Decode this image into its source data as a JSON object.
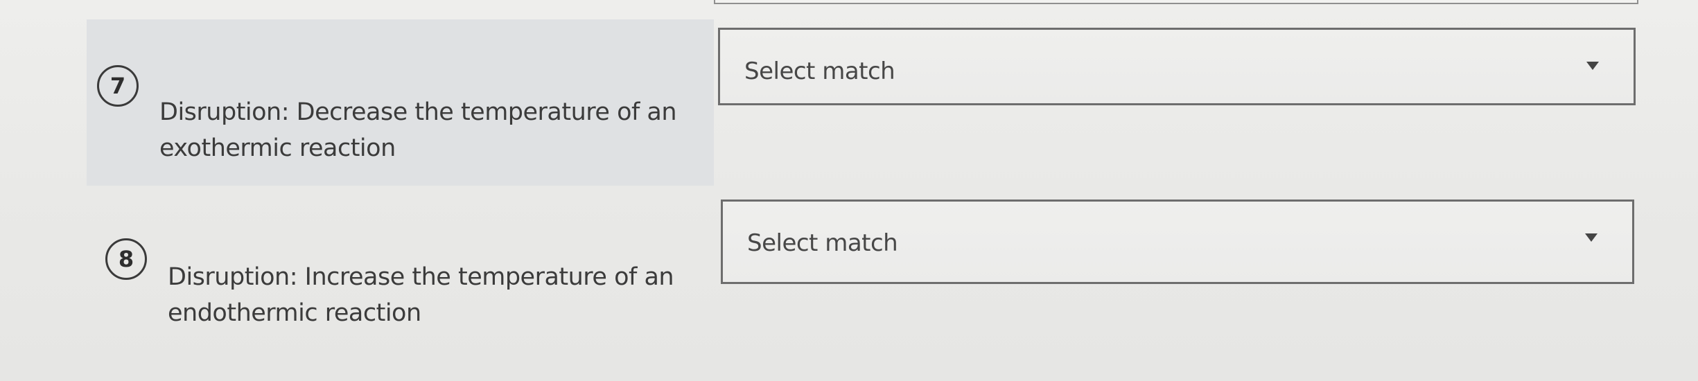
{
  "questions": [
    {
      "number": "7",
      "prompt_line1": "Disruption: Decrease the temperature of an",
      "prompt_line2": "exothermic reaction",
      "select": {
        "value": "Select match"
      },
      "highlighted": true
    },
    {
      "number": "8",
      "prompt_line1": "Disruption: Increase the temperature of an",
      "prompt_line2": "endothermic reaction",
      "select": {
        "value": "Select match"
      },
      "highlighted": false
    }
  ],
  "icons": {
    "dropdown": "chevron-down-icon"
  },
  "colors": {
    "background": "#ececea",
    "highlight": "#dfe1e3",
    "border": "#6d6d6d",
    "text": "#3b3b3b"
  }
}
